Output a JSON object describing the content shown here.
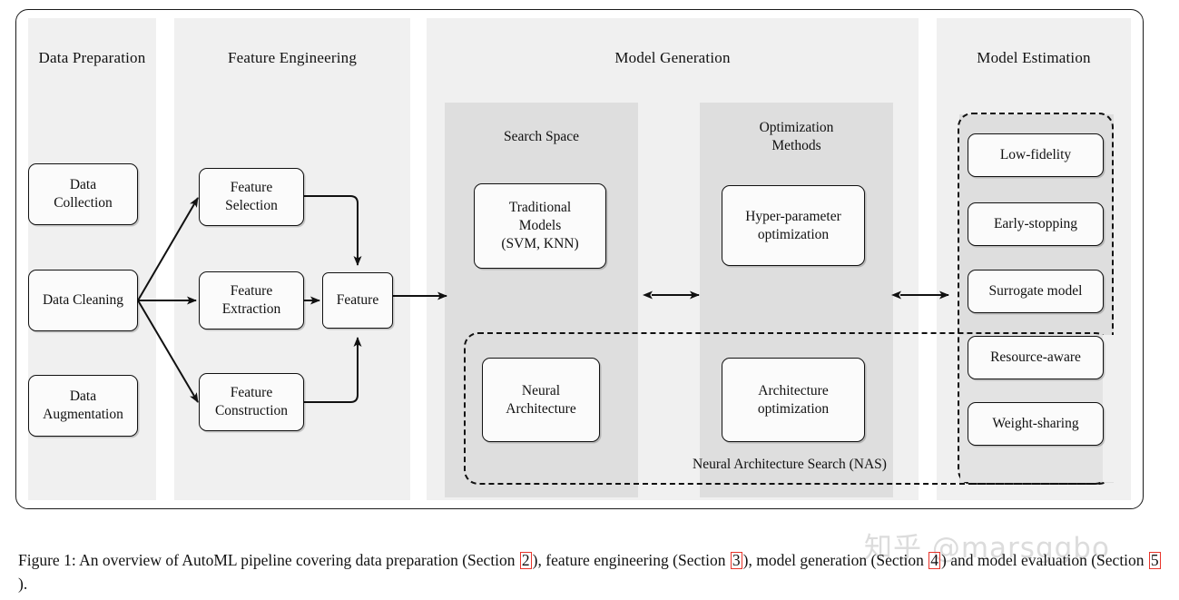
{
  "figure": {
    "stages": [
      {
        "id": "data-preparation",
        "title": "Data Preparation"
      },
      {
        "id": "feature-engineering",
        "title": "Feature Engineering"
      },
      {
        "id": "model-generation",
        "title": "Model Generation"
      },
      {
        "id": "model-estimation",
        "title": "Model Estimation"
      }
    ],
    "data_preparation": {
      "nodes": [
        {
          "id": "data-collection",
          "label": "Data\nCollection"
        },
        {
          "id": "data-cleaning",
          "label": "Data Cleaning"
        },
        {
          "id": "data-augmentation",
          "label": "Data\nAugmentation"
        }
      ]
    },
    "feature_engineering": {
      "nodes": [
        {
          "id": "feature-selection",
          "label": "Feature\nSelection"
        },
        {
          "id": "feature-extraction",
          "label": "Feature\nExtraction"
        },
        {
          "id": "feature-construction",
          "label": "Feature\nConstruction"
        },
        {
          "id": "feature",
          "label": "Feature"
        }
      ]
    },
    "model_generation": {
      "subpanels": [
        {
          "id": "search-space",
          "title": "Search Space"
        },
        {
          "id": "optimization-methods",
          "title": "Optimization\nMethods"
        }
      ],
      "nodes": [
        {
          "id": "traditional-models",
          "label": "Traditional\nModels\n(SVM, KNN)"
        },
        {
          "id": "hyper-parameter-optimization",
          "label": "Hyper-parameter\noptimization"
        },
        {
          "id": "neural-architecture",
          "label": "Neural\nArchitecture"
        },
        {
          "id": "architecture-optimization",
          "label": "Architecture\noptimization"
        }
      ],
      "nas_label": "Neural Architecture Search (NAS)"
    },
    "model_estimation": {
      "nodes": [
        {
          "id": "low-fidelity",
          "label": "Low-fidelity"
        },
        {
          "id": "early-stopping",
          "label": "Early-stopping"
        },
        {
          "id": "surrogate-model",
          "label": "Surrogate model"
        },
        {
          "id": "resource-aware",
          "label": "Resource-aware"
        },
        {
          "id": "weight-sharing",
          "label": "Weight-sharing"
        }
      ]
    }
  },
  "caption": {
    "part1": "Figure 1: An overview of AutoML pipeline covering data preparation (Section ",
    "ref1": "2",
    "part2": "), feature engineering (Section ",
    "ref2": "3",
    "part3": "), model generation (Section ",
    "ref3": "4",
    "part4": ") and model evaluation (Section ",
    "ref4": "5",
    "part5": ")."
  },
  "watermark": {
    "text": "知乎 @marsggbo"
  },
  "colors": {
    "panel_bg": "#f0f0f0",
    "subpanel_bg": "#dedede",
    "node_bg": "#fbfbfb",
    "stroke": "#111111",
    "ref_box": "#e8342a",
    "watermark": "#dcdcdc"
  }
}
